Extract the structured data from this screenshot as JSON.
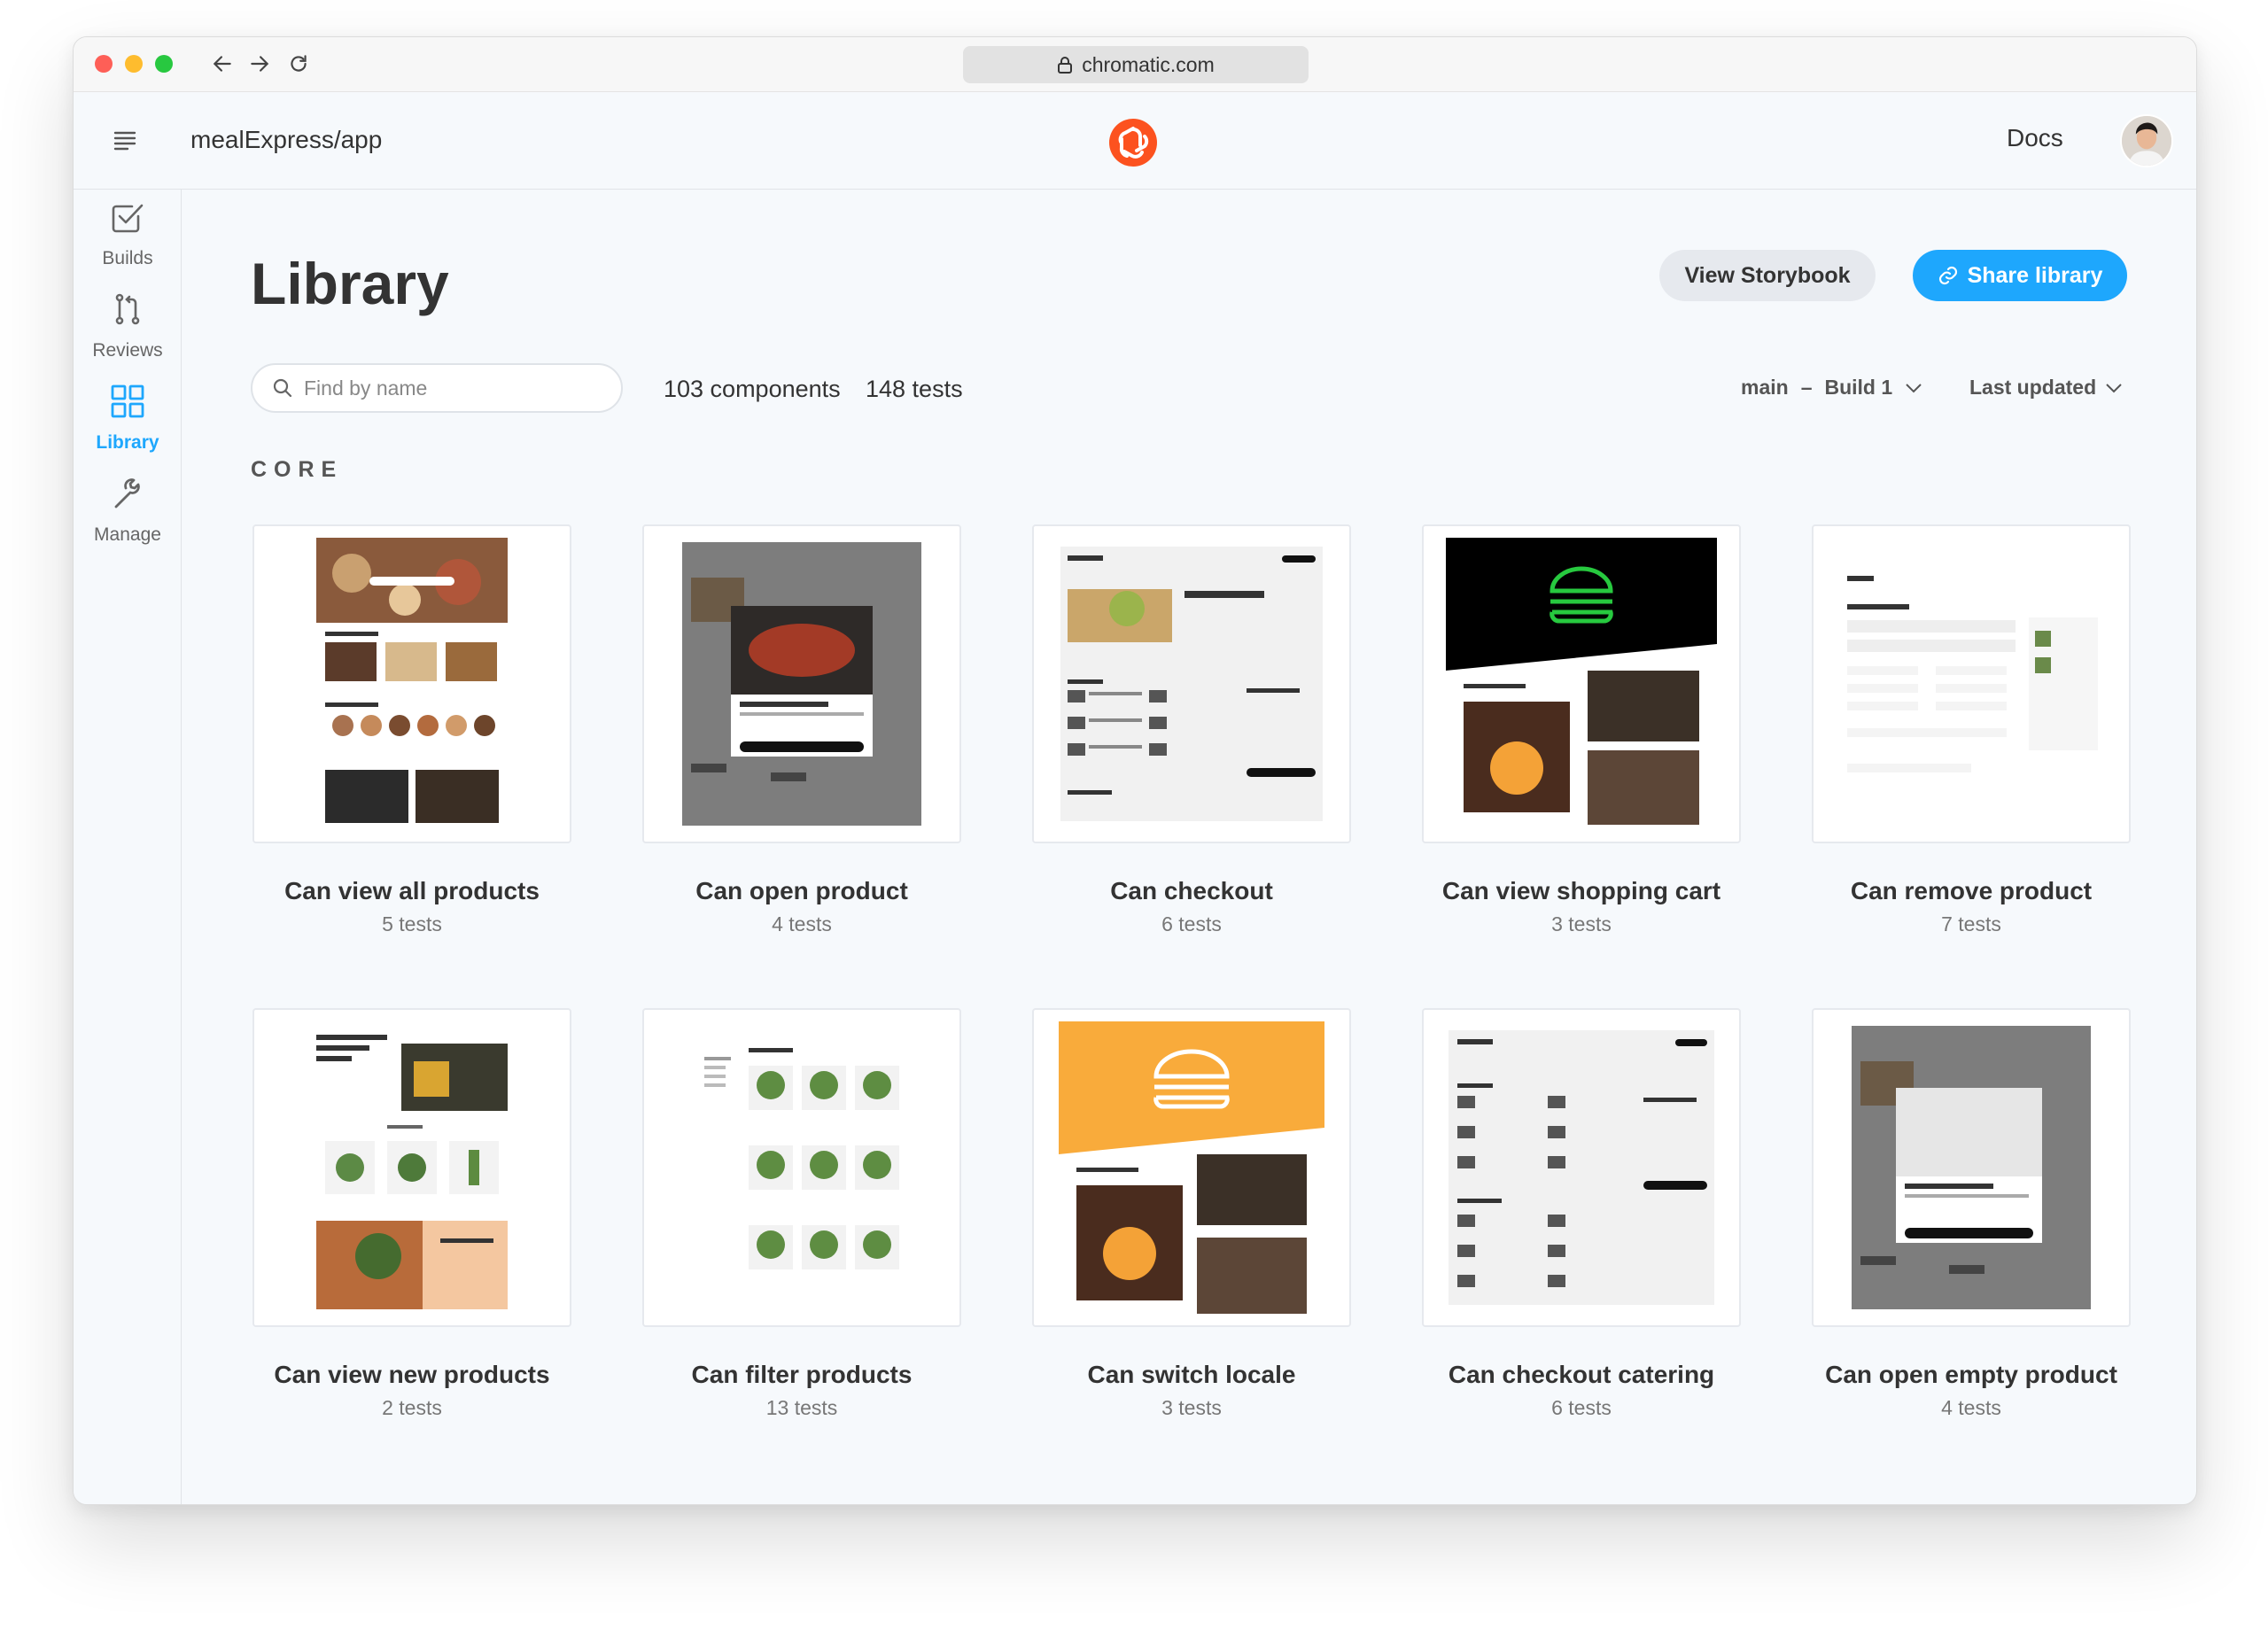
{
  "browser": {
    "url": "chromatic.com"
  },
  "header": {
    "project": "mealExpress/app",
    "docs": "Docs"
  },
  "sidebar": {
    "items": [
      {
        "label": "Builds",
        "icon": "checkbox-icon"
      },
      {
        "label": "Reviews",
        "icon": "pull-request-icon"
      },
      {
        "label": "Library",
        "icon": "grid-icon",
        "active": true
      },
      {
        "label": "Manage",
        "icon": "wrench-icon"
      }
    ]
  },
  "main": {
    "title": "Library",
    "view_storybook": "View Storybook",
    "share_library": "Share library",
    "search_placeholder": "Find by name",
    "components": "103 components",
    "tests": "148 tests",
    "branch": "main",
    "build": "Build 1",
    "sort": "Last updated",
    "section": "CORE"
  },
  "cards": [
    {
      "title": "Can view all products",
      "tests": "5 tests"
    },
    {
      "title": "Can open product",
      "tests": "4 tests"
    },
    {
      "title": "Can checkout",
      "tests": "6 tests"
    },
    {
      "title": "Can view shopping cart",
      "tests": "3 tests"
    },
    {
      "title": "Can remove product",
      "tests": "7 tests"
    },
    {
      "title": "Can view new products",
      "tests": "2 tests"
    },
    {
      "title": "Can filter products",
      "tests": "13 tests"
    },
    {
      "title": "Can switch locale",
      "tests": "3 tests"
    },
    {
      "title": "Can checkout catering",
      "tests": "6 tests"
    },
    {
      "title": "Can open empty product",
      "tests": "4 tests"
    }
  ],
  "colors": {
    "accent": "#1ea7fd",
    "brand": "#fc521f",
    "background": "#f6f9fc"
  }
}
